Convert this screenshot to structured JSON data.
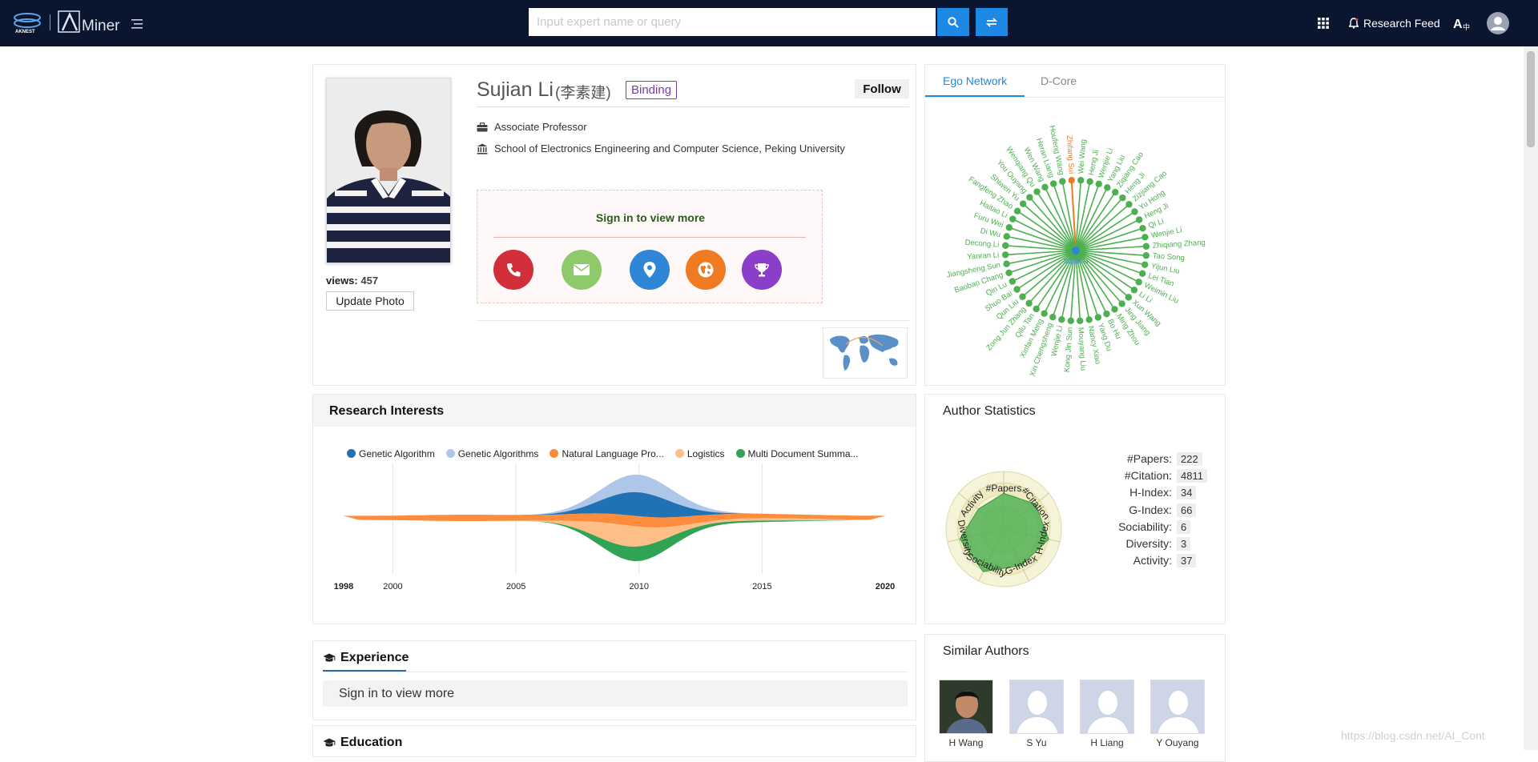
{
  "header": {
    "brand": "Miner",
    "search_placeholder": "Input expert name or query",
    "research_feed": "Research Feed"
  },
  "profile": {
    "name": "Sujian Li",
    "chinese_name": "(李素建)",
    "binding": "Binding",
    "follow": "Follow",
    "position": "Associate Professor",
    "affiliation": "School of Electronics Engineering and Computer Science, Peking University",
    "views_label": "views:",
    "views": "457",
    "update_photo": "Update Photo",
    "sign_in": "Sign in to view more"
  },
  "network": {
    "tabs": [
      "Ego Network",
      "D-Core"
    ],
    "active_tab": "Ego Network",
    "center": "Sujian Li",
    "highlighted": "Zhifang Sui",
    "names": [
      "Zhifang Sui",
      "Wei Wang",
      "Heng Ji",
      "Wenjie Li",
      "Yang Liu",
      "Ziqiang Cao",
      "Heng Ji",
      "Zizjiang Cao",
      "Yu Hong",
      "Heng Ji",
      "Qi Li",
      "Wenjie Li",
      "Zhiqiang Zhang",
      "Tao Song",
      "Yijun Liu",
      "Lei Tian",
      "Weimin Liu",
      "Li Li",
      "Xun Wang",
      "Jing Jiang",
      "Ming Zhou",
      "Bo Hu",
      "Yang Du",
      "Nancy Xiao",
      "Mouyang Liu",
      "Kong Jin Sun",
      "Wenjie Li",
      "Xin Chengsheng",
      "Xinfan Meng",
      "Qilu Tan",
      "Zong Jun Zhang",
      "Qun Liu",
      "Shuo Bai",
      "Qin Lu",
      "Baobao Chang",
      "Jiangsheng Sun",
      "Yanran Li",
      "Decong Li",
      "Di Wu",
      "Furu Wei",
      "Haitao Li",
      "Fangfeng Zhao",
      "Shiwen Yu",
      "You Ouyang",
      "Wenqiang Qu",
      "Wen Wang",
      "Heran Liang",
      "Houfeng Wang"
    ]
  },
  "research": {
    "title": "Research Interests",
    "chart_data": {
      "type": "area",
      "subtype": "streamgraph",
      "x_range": [
        1998,
        2020
      ],
      "x_ticks": [
        "1998",
        "2000",
        "2005",
        "2010",
        "2015",
        "2020"
      ],
      "series": [
        {
          "name": "Genetic Algorithm",
          "color": "#2171b5"
        },
        {
          "name": "Genetic Algorithms",
          "color": "#aec7e8"
        },
        {
          "name": "Natural Language Pro...",
          "color": "#fd8d3c"
        },
        {
          "name": "Logistics",
          "color": "#fdbf87"
        },
        {
          "name": "Multi Document Summa...",
          "color": "#31a354"
        }
      ]
    }
  },
  "stats": {
    "title": "Author Statistics",
    "axes": [
      "#Papers",
      "#Citation",
      "H-Index",
      "G-Index",
      "Sociability",
      "Diversity",
      "Activity"
    ],
    "rows": [
      {
        "label": "#Papers:",
        "value": "222"
      },
      {
        "label": "#Citation:",
        "value": "4811"
      },
      {
        "label": "H-Index:",
        "value": "34"
      },
      {
        "label": "G-Index:",
        "value": "66"
      },
      {
        "label": "Sociability:",
        "value": "6"
      },
      {
        "label": "Diversity:",
        "value": "3"
      },
      {
        "label": "Activity:",
        "value": "37"
      }
    ]
  },
  "experience": {
    "title": "Experience",
    "sign_in": "Sign in to view more"
  },
  "education": {
    "title": "Education"
  },
  "similar": {
    "title": "Similar Authors",
    "authors": [
      {
        "name": "H Wang"
      },
      {
        "name": "S Yu"
      },
      {
        "name": "H Liang"
      },
      {
        "name": "Y Ouyang"
      }
    ]
  },
  "watermark": "https://blog.csdn.net/AI_Cont",
  "colors": {
    "navbar": "#0a1530",
    "primary": "#1e88e5",
    "accent_purple": "#7b3aa8"
  }
}
